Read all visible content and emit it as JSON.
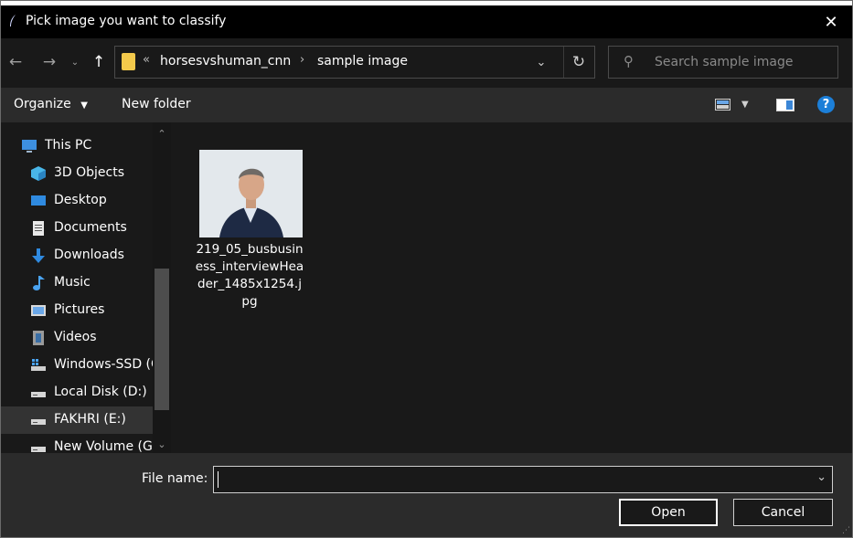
{
  "window": {
    "title": "Pick image you want to classify",
    "close_glyph": "✕"
  },
  "address": {
    "overflow_glyph": "«",
    "crumbs": [
      "horsesvshuman_cnn",
      "sample image"
    ],
    "search_placeholder": "Search sample image"
  },
  "toolbar": {
    "organize_label": "Organize",
    "new_folder_label": "New folder",
    "help_glyph": "?"
  },
  "nav": {
    "items": [
      {
        "label": "This PC",
        "icon": "this-pc-icon"
      },
      {
        "label": "3D Objects",
        "icon": "3d-objects-icon"
      },
      {
        "label": "Desktop",
        "icon": "desktop-icon"
      },
      {
        "label": "Documents",
        "icon": "documents-icon"
      },
      {
        "label": "Downloads",
        "icon": "downloads-icon"
      },
      {
        "label": "Music",
        "icon": "music-icon"
      },
      {
        "label": "Pictures",
        "icon": "pictures-icon"
      },
      {
        "label": "Videos",
        "icon": "videos-icon"
      },
      {
        "label": "Windows-SSD (C",
        "icon": "system-drive-icon"
      },
      {
        "label": "Local Disk (D:)",
        "icon": "drive-icon"
      },
      {
        "label": "FAKHRI (E:)",
        "icon": "drive-icon",
        "selected": true
      },
      {
        "label": "New Volume (G:",
        "icon": "drive-icon"
      }
    ]
  },
  "files": [
    {
      "name": "219_05_busbusiness_interviewHeader_1485x1254.jpg",
      "icon": "photo-thumbnail"
    }
  ],
  "footer": {
    "file_name_label": "File name:",
    "file_name_value": "",
    "open_label": "Open",
    "cancel_label": "Cancel"
  },
  "colors": {
    "background": "#191919",
    "toolbar": "#2b2b2b",
    "accent": "#1c7fd8",
    "folder": "#f3c94b"
  }
}
